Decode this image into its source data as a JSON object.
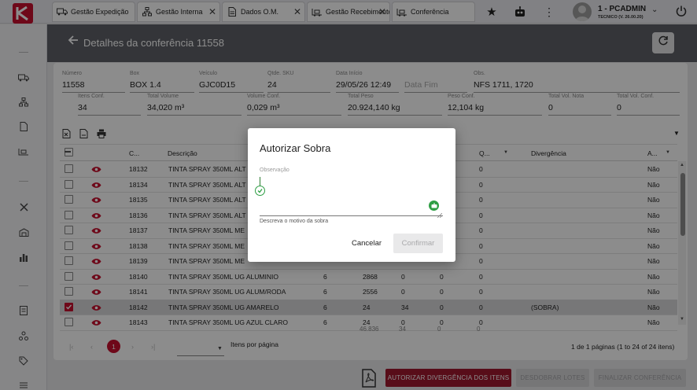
{
  "tabs": [
    {
      "label": "Gestão Expedição",
      "icon": "truck-icon"
    },
    {
      "label": "Gestão Interna",
      "icon": "hierarchy-icon"
    },
    {
      "label": "Dados O.M.",
      "icon": "document-icon"
    },
    {
      "label": "Gestão Recebimento",
      "icon": "forklift-icon"
    },
    {
      "label": "Conferência",
      "icon": "forklift-icon"
    }
  ],
  "topbar": {
    "user_name": "1 - PCADMIN",
    "user_role": "TECNICO (V. 26.00.20)"
  },
  "header": {
    "title": "Detalhes da conferência 11558"
  },
  "fields_row1": [
    {
      "label": "Número",
      "value": "11558"
    },
    {
      "label": "Box",
      "value": "BOX 1.4"
    },
    {
      "label": "Veículo",
      "value": "GJC0D15"
    },
    {
      "label": "Qtde. SKU",
      "value": "24"
    },
    {
      "label": "Data Início",
      "value": "29/05/26 12:49"
    },
    {
      "label": "",
      "value": "Data Fim"
    },
    {
      "label": "Obs.",
      "value": "NFS 1711, 1720"
    }
  ],
  "fields_row2": [
    {
      "label": "Itens Conf.",
      "value": "34"
    },
    {
      "label": "Total Volume",
      "value": "34,020 m³"
    },
    {
      "label": "Volume Conf.",
      "value": "0,029 m³"
    },
    {
      "label": "Total Peso",
      "value": "20.924,140 kg"
    },
    {
      "label": "Peso Conf.",
      "value": "12,104 kg"
    },
    {
      "label": "Total Vol. Nota",
      "value": "0"
    },
    {
      "label": "Total Vol. Conf.",
      "value": "0"
    }
  ],
  "table": {
    "headers": {
      "code": "C...",
      "desc": "Descrição",
      "q": "Q...",
      "div": "Divergência",
      "a": "A..."
    },
    "rows": [
      {
        "code": "18132",
        "desc": "TINTA SPRAY 350ML ALT",
        "c1": "",
        "c2": "",
        "c3": "",
        "c4": "",
        "q": "0",
        "div": "",
        "a": "Não",
        "checked": false
      },
      {
        "code": "18134",
        "desc": "TINTA SPRAY 350ML ALT",
        "c1": "",
        "c2": "",
        "c3": "",
        "c4": "",
        "q": "0",
        "div": "",
        "a": "Não",
        "checked": false
      },
      {
        "code": "18135",
        "desc": "TINTA SPRAY 350ML ALT",
        "c1": "",
        "c2": "",
        "c3": "",
        "c4": "",
        "q": "0",
        "div": "",
        "a": "Não",
        "checked": false
      },
      {
        "code": "18136",
        "desc": "TINTA SPRAY 350ML ALT",
        "c1": "",
        "c2": "",
        "c3": "",
        "c4": "",
        "q": "0",
        "div": "",
        "a": "Não",
        "checked": false
      },
      {
        "code": "18137",
        "desc": "TINTA SPRAY 350ML ME",
        "c1": "",
        "c2": "",
        "c3": "",
        "c4": "",
        "q": "0",
        "div": "",
        "a": "Não",
        "checked": false
      },
      {
        "code": "18138",
        "desc": "TINTA SPRAY 350ML ME",
        "c1": "",
        "c2": "",
        "c3": "",
        "c4": "",
        "q": "0",
        "div": "",
        "a": "Não",
        "checked": false
      },
      {
        "code": "18139",
        "desc": "TINTA SPRAY 350ML ME",
        "c1": "",
        "c2": "",
        "c3": "",
        "c4": "",
        "q": "0",
        "div": "",
        "a": "Não",
        "checked": false
      },
      {
        "code": "18140",
        "desc": "TINTA SPRAY 350ML UG ALUMINIO",
        "c1": "6",
        "c2": "2868",
        "c3": "0",
        "c4": "0",
        "q": "0",
        "div": "",
        "a": "Não",
        "checked": false
      },
      {
        "code": "18141",
        "desc": "TINTA SPRAY 350ML UG ALUM/RODA",
        "c1": "6",
        "c2": "2556",
        "c3": "0",
        "c4": "0",
        "q": "0",
        "div": "",
        "a": "Não",
        "checked": false
      },
      {
        "code": "18142",
        "desc": "TINTA SPRAY 350ML UG AMARELO",
        "c1": "6",
        "c2": "24",
        "c3": "34",
        "c4": "0",
        "q": "0",
        "div": "(SOBRA)",
        "a": "Não",
        "checked": true
      },
      {
        "code": "18143",
        "desc": "TINTA SPRAY 350ML UG AZUL CLARO",
        "c1": "6",
        "c2": "24",
        "c3": "0",
        "c4": "0",
        "q": "0",
        "div": "",
        "a": "Não",
        "checked": false
      }
    ],
    "totals": {
      "c2": "46.836",
      "c3": "34",
      "c4": "0",
      "q": "0"
    }
  },
  "pagination": {
    "current_page": "1",
    "items_label": "Itens por página",
    "summary": "1 de 1 páginas (1 to 24 of 24 itens)"
  },
  "actions": {
    "authorize": "AUTORIZAR DIVERGÊNCIA DOS ITENS",
    "split": "DESDOBRAR LOTES",
    "finalize": "FINALIZAR CONFERÊNCIA"
  },
  "dialog": {
    "title": "Autorizar Sobra",
    "obs_label": "Observação",
    "hint": "Descreva o motivo da sobra",
    "cancel": "Cancelar",
    "confirm": "Confirmar"
  },
  "colors": {
    "accent": "#c8102e",
    "header": "#5f6268"
  }
}
